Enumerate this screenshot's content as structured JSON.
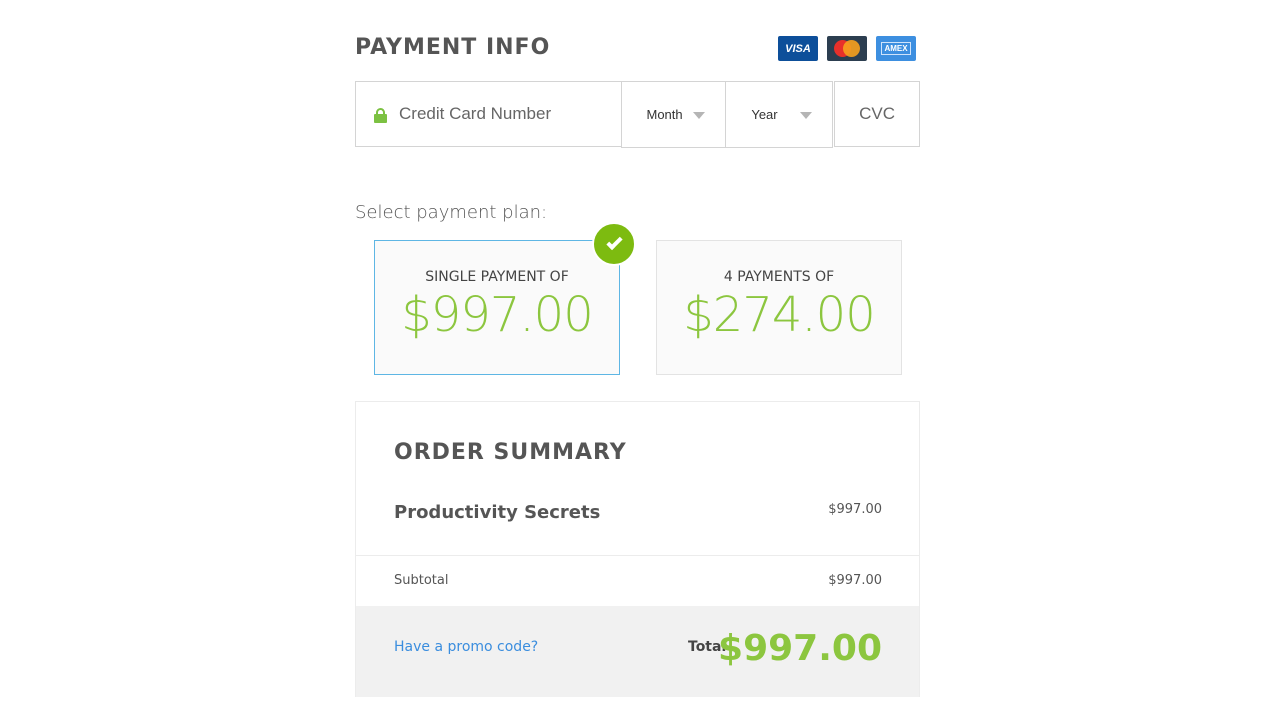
{
  "payment": {
    "title": "PAYMENT INFO",
    "card_logos": [
      {
        "name": "visa",
        "label": "VISA"
      },
      {
        "name": "mastercard"
      },
      {
        "name": "amex",
        "label": "AMEX"
      }
    ],
    "card_number_placeholder": "Credit Card Number",
    "month_label": "Month",
    "year_label": "Year",
    "cvc_placeholder": "CVC",
    "accent_green": "#8cc63f",
    "selected_border": "#5eb6e4"
  },
  "plans": {
    "label": "Select payment plan:",
    "options": [
      {
        "label": "SINGLE PAYMENT OF",
        "amount": "$997.00",
        "selected": true
      },
      {
        "label": "4 PAYMENTS OF",
        "amount": "$274.00",
        "selected": false
      }
    ]
  },
  "summary": {
    "title": "ORDER SUMMARY",
    "item_name": "Productivity Secrets",
    "item_price": "$997.00",
    "subtotal_label": "Subtotal",
    "subtotal_value": "$997.00",
    "promo_link": "Have a promo code?",
    "total_label": "Total",
    "total_value": "$997.00"
  }
}
